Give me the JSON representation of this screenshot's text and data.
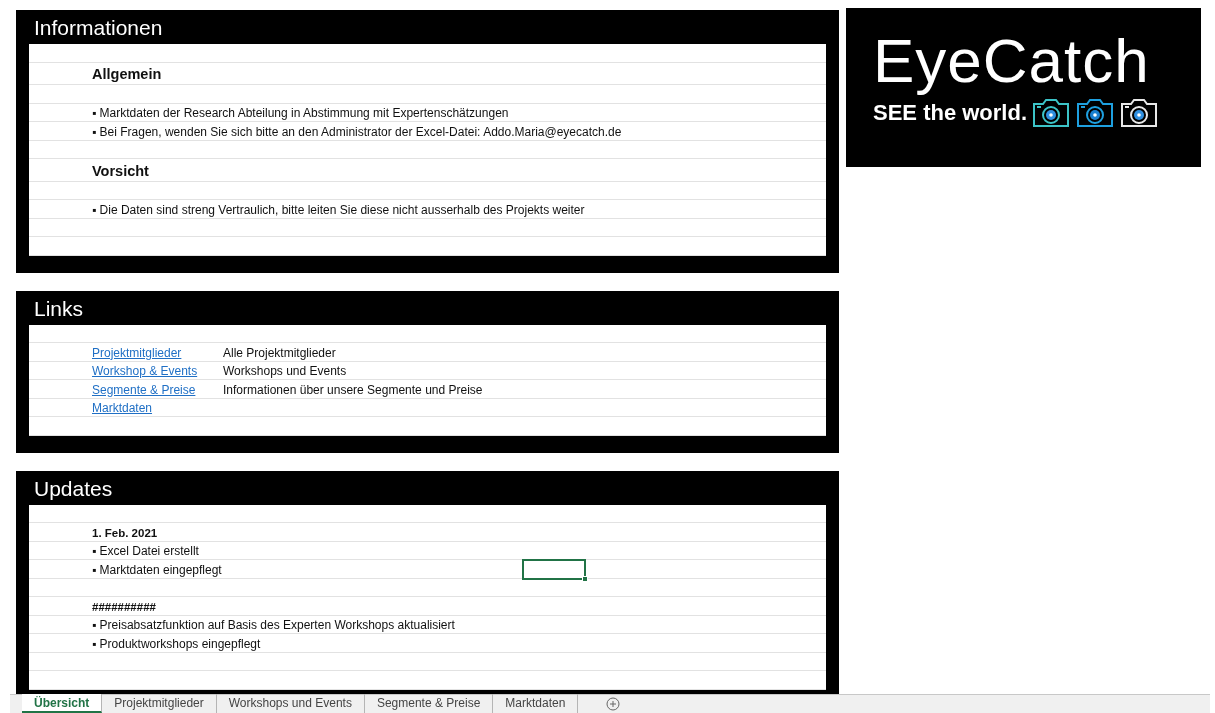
{
  "sections": [
    {
      "title": "Informationen",
      "rows": [
        {
          "kind": "blank",
          "selected": false
        },
        {
          "kind": "heading",
          "text": "Allgemein",
          "selected": false
        },
        {
          "kind": "blank",
          "selected": false
        },
        {
          "kind": "bullet",
          "text": "▪ Marktdaten der Research Abteilung in Abstimmung mit Expertenschätzungen",
          "selected": false
        },
        {
          "kind": "bullet",
          "text": "▪ Bei Fragen, wenden Sie sich bitte an den Administrator der Excel-Datei: Addo.Maria@eyecatch.de",
          "selected": false
        },
        {
          "kind": "blank",
          "selected": false
        },
        {
          "kind": "heading",
          "text": "Vorsicht",
          "selected": false
        },
        {
          "kind": "blank",
          "selected": false
        },
        {
          "kind": "bullet",
          "text": "▪ Die Daten sind streng Vertraulich, bitte leiten Sie diese nicht ausserhalb des Projekts weiter",
          "selected": false
        },
        {
          "kind": "blank",
          "selected": false
        },
        {
          "kind": "blank",
          "selected": false
        }
      ]
    },
    {
      "title": "Links",
      "rows": [
        {
          "kind": "blank",
          "selected": false
        },
        {
          "kind": "link",
          "text": "Projektmitglieder",
          "description": "Alle Projektmitglieder",
          "selected": false
        },
        {
          "kind": "link",
          "text": "Workshop & Events",
          "description": "Workshops und Events",
          "selected": false
        },
        {
          "kind": "link",
          "text": "Segmente & Preise",
          "description": "Informationen über unsere Segmente und Preise",
          "selected": false
        },
        {
          "kind": "link",
          "text": "Marktdaten",
          "selected": false
        },
        {
          "kind": "blank",
          "selected": false
        }
      ]
    },
    {
      "title": "Updates",
      "rows": [
        {
          "kind": "blank",
          "selected": false
        },
        {
          "kind": "date",
          "text": "1. Feb. 2021",
          "selected": false
        },
        {
          "kind": "bullet",
          "text": "▪ Excel Datei erstellt",
          "selected": false
        },
        {
          "kind": "bullet",
          "text": "▪ Marktdaten eingepflegt",
          "selected": true
        },
        {
          "kind": "blank",
          "selected": false
        },
        {
          "kind": "date",
          "text": "##########",
          "selected": false
        },
        {
          "kind": "bullet",
          "text": "▪ Preisabsatzfunktion auf Basis des Experten Workshops aktualisiert",
          "selected": false
        },
        {
          "kind": "bullet",
          "text": "▪ Produktworkshops eingepflegt",
          "selected": false
        },
        {
          "kind": "blank",
          "selected": false
        },
        {
          "kind": "blank",
          "selected": false
        }
      ]
    }
  ],
  "logo": {
    "name": "EyeCatch",
    "tagline": "**SEE** the world."
  },
  "sheet_tabs": [
    {
      "label": "Übersicht",
      "selected": true
    },
    {
      "label": "Projektmitglieder",
      "selected": false
    },
    {
      "label": "Workshops und Events",
      "selected": false
    },
    {
      "label": "Segmente & Preise",
      "selected": false
    },
    {
      "label": "Marktdaten",
      "selected": false
    }
  ]
}
